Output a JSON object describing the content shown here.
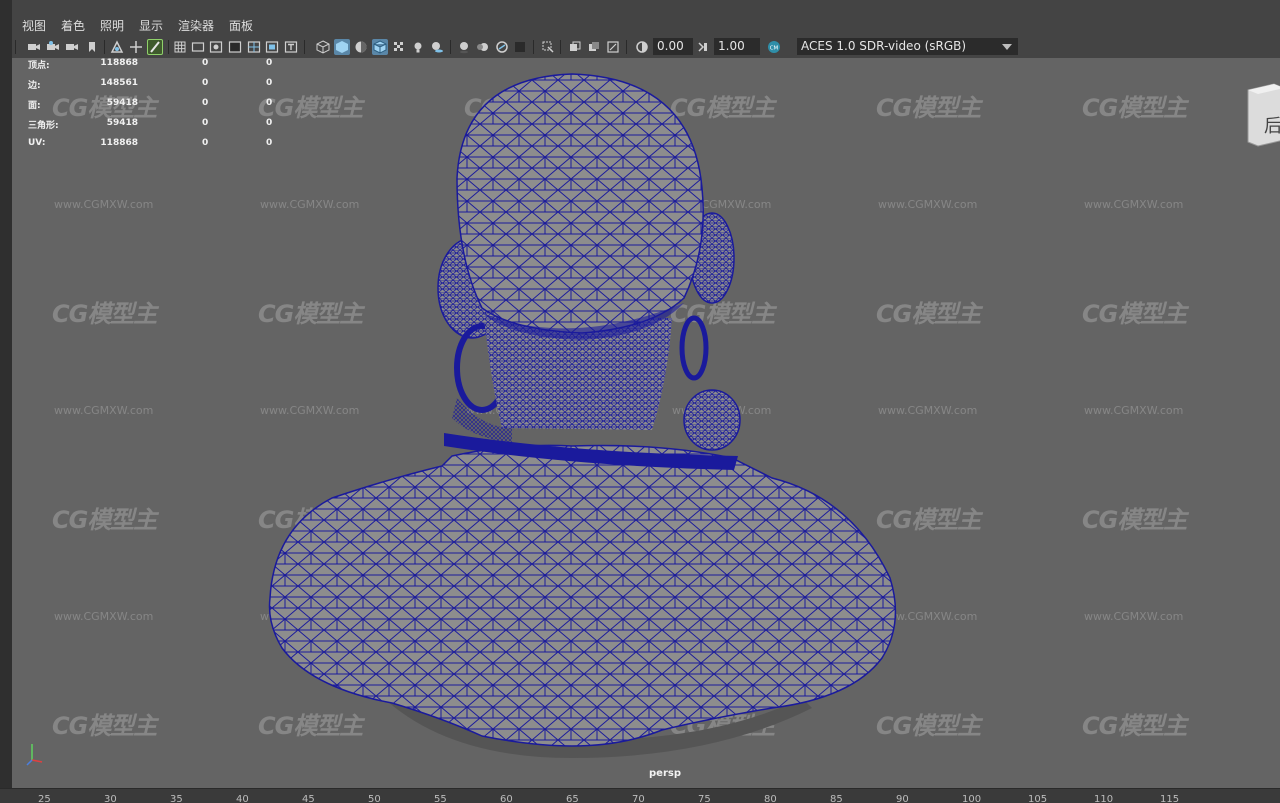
{
  "menu": [
    "视图",
    "着色",
    "照明",
    "显示",
    "渲染器",
    "面板"
  ],
  "toolbar": {
    "exposure_value": "0.00",
    "gamma_value": "1.00",
    "color_space": "ACES 1.0 SDR-video (sRGB)",
    "icons": [
      "select-camera-icon",
      "camera-attributes-icon",
      "bookmark-icon",
      "image-plane-icon",
      "grid-icon",
      "film-gate-icon",
      "resolution-gate-icon",
      "gate-mask-icon",
      "field-chart-icon",
      "safe-action-icon",
      "safe-title-icon",
      "wireframe-icon",
      "smooth-shade-icon",
      "default-material-icon",
      "wireframe-on-shaded-icon",
      "textured-icon",
      "use-all-lights-icon",
      "shadows-icon",
      "screen-space-ao-icon",
      "motion-blur-icon",
      "multisample-aa-icon",
      "depth-of-field-icon",
      "isolate-select-icon",
      "xray-icon",
      "xray-active-components-icon",
      "xray-joints-icon",
      "exposure-icon",
      "gamma-icon",
      "color-management-icon"
    ]
  },
  "hud": {
    "rows": [
      {
        "label": "顶点:",
        "v1": "118868",
        "v2": "0",
        "v3": "0"
      },
      {
        "label": "边:",
        "v1": "148561",
        "v2": "0",
        "v3": "0"
      },
      {
        "label": "面:",
        "v1": "59418",
        "v2": "0",
        "v3": "0"
      },
      {
        "label": "三角形:",
        "v1": "59418",
        "v2": "0",
        "v3": "0"
      },
      {
        "label": "UV:",
        "v1": "118868",
        "v2": "0",
        "v3": "0"
      }
    ]
  },
  "watermark": {
    "logo": "CG模型主",
    "url": "www.CGMXW.com"
  },
  "view_cube_text": "后",
  "camera_label": "persp",
  "ruler": [
    "25",
    "30",
    "35",
    "40",
    "45",
    "50",
    "55",
    "60",
    "65",
    "70",
    "75",
    "80",
    "85",
    "90",
    "100",
    "105",
    "110",
    "115"
  ],
  "colors": {
    "wire": "#1a1a9c",
    "surface": "#8d8d8d",
    "viewport": "#646464"
  }
}
